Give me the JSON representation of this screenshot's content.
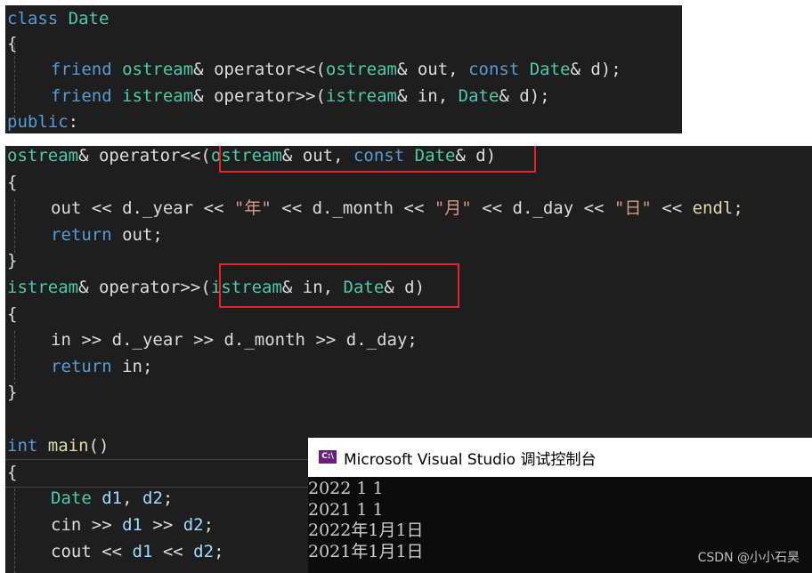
{
  "code_top": {
    "class_kw": "class",
    "class_name": "Date",
    "brace_open": "{",
    "friend1": {
      "kw": "friend",
      "ret": "ostream",
      "amp": "&",
      "op": " operator<<(",
      "p1t": "ostream",
      "p1": "& out, ",
      "const": "const",
      "p2t": "Date",
      "p2": "& d);"
    },
    "friend2": {
      "kw": "friend",
      "ret": "istream",
      "amp": "&",
      "op": " operator>>(",
      "p1t": "istream",
      "p1": "& in, ",
      "p2t": "Date",
      "p2": "& d);"
    },
    "access": "public",
    "access_colon": ":"
  },
  "code_main": {
    "out_sig": {
      "ret": "ostream",
      "amp": "& ",
      "op": "operator<<",
      "paren": "(",
      "p1t": "ostream",
      "p1": "& out, ",
      "const": "const",
      "p2t": "Date",
      "p2": "& d)"
    },
    "brace_open": "{",
    "out_body": {
      "a": "out << d.",
      "year": "_year",
      "b": " << ",
      "s1": "\"年\"",
      "c": " << d.",
      "month": "_month",
      "d": " << ",
      "s2": "\"月\"",
      "e": " << d.",
      "day": "_day",
      "f": " << ",
      "s3": "\"日\"",
      "g": " << ",
      "endl": "endl",
      "h": ";"
    },
    "ret_out": {
      "kw": "return",
      "rest": " out;"
    },
    "brace_close": "}",
    "in_sig": {
      "ret": "istream",
      "amp": "& ",
      "op": "operator>>",
      "paren": "(",
      "p1t": "istream",
      "p1": "& in, ",
      "p2t": "Date",
      "p2": "& d)"
    },
    "in_body": {
      "a": "in >> d.",
      "year": "_year",
      "b": " >> d.",
      "month": "_month",
      "c": " >> d.",
      "day": "_day",
      "d": ";"
    },
    "ret_in": {
      "kw": "return",
      "rest": " in;"
    },
    "main_sig": {
      "kw": "int",
      "name": "main",
      "rest": "()"
    },
    "decl": {
      "type": "Date",
      "v1": "d1",
      "sep": ", ",
      "v2": "d2",
      "end": ";"
    },
    "cin": {
      "a": "cin >> ",
      "v1": "d1",
      "b": " >> ",
      "v2": "d2",
      "end": ";"
    },
    "cout": {
      "a": "cout << ",
      "v1": "d1",
      "b": " << ",
      "v2": "d2",
      "end": ";"
    }
  },
  "console": {
    "title": "Microsoft Visual Studio 调试控制台",
    "icon_label": "C:\\",
    "icon": "console-app-icon",
    "lines": [
      "2022 1 1",
      "2021 1 1",
      "2022年1月1日",
      "2021年1月1日"
    ]
  },
  "watermark": "CSDN @小小石昊",
  "colors": {
    "editor_bg": "#1e1e1e",
    "keyword": "#569cd6",
    "type": "#4ec9b0",
    "function": "#dcdcaa",
    "string": "#d69d85",
    "highlight_box": "#e3262b"
  }
}
